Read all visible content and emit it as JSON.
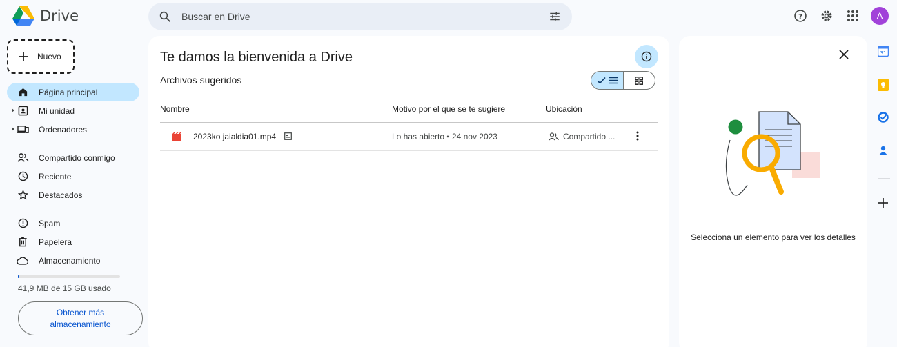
{
  "app": {
    "name": "Drive"
  },
  "search": {
    "placeholder": "Buscar en Drive"
  },
  "header": {
    "avatar_letter": "A"
  },
  "nav": {
    "new_label": "Nuevo",
    "items": [
      {
        "label": "Página principal",
        "icon": "home-icon"
      },
      {
        "label": "Mi unidad",
        "icon": "drive-icon"
      },
      {
        "label": "Ordenadores",
        "icon": "computer-icon"
      },
      {
        "label": "Compartido conmigo",
        "icon": "people-icon"
      },
      {
        "label": "Reciente",
        "icon": "clock-icon"
      },
      {
        "label": "Destacados",
        "icon": "star-icon"
      },
      {
        "label": "Spam",
        "icon": "spam-icon"
      },
      {
        "label": "Papelera",
        "icon": "trash-icon"
      },
      {
        "label": "Almacenamiento",
        "icon": "cloud-icon"
      }
    ],
    "storage_text": "41,9 MB de 15 GB usado",
    "storage_used_fraction": 0.0027,
    "get_more_label": "Obtener más almacenamiento"
  },
  "main": {
    "title": "Te damos la bienvenida a Drive",
    "subtitle": "Archivos sugeridos",
    "columns": {
      "name": "Nombre",
      "reason": "Motivo por el que se te sugiere",
      "location": "Ubicación"
    },
    "rows": [
      {
        "name": "2023ko jaialdia01.mp4",
        "reason": "Lo has abierto • 24 nov 2023",
        "location": "Compartido ..."
      }
    ]
  },
  "details": {
    "empty_text": "Selecciona un elemento para ver los detalles"
  },
  "colors": {
    "accent": "#0b57d0",
    "active_bg": "#c2e7ff",
    "video_red": "#ea4335",
    "avatar": "#a142d9"
  }
}
